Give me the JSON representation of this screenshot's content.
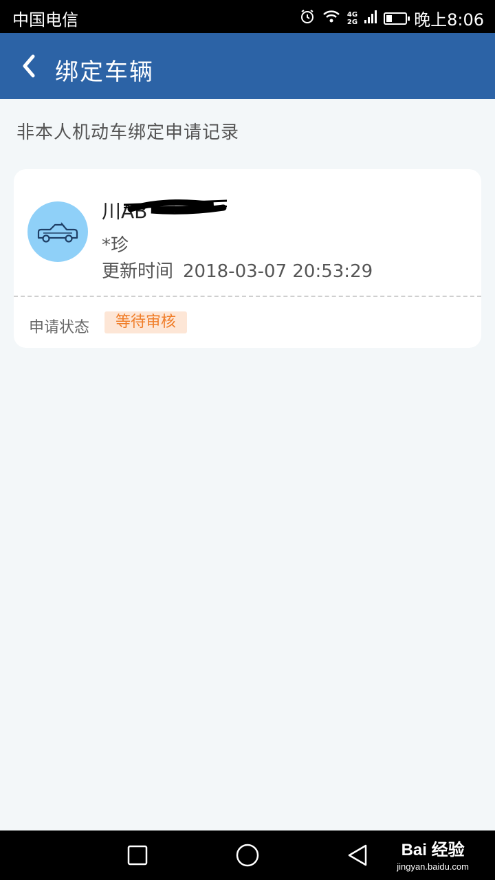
{
  "status_bar": {
    "carrier": "中国电信",
    "network": "4G",
    "network2": "2G",
    "time": "晚上8:06",
    "icons": [
      "alarm-icon",
      "wifi-icon",
      "signal-icon",
      "battery-icon"
    ]
  },
  "app_bar": {
    "back_icon": "chevron-left-icon",
    "title": "绑定车辆"
  },
  "section": {
    "title": "非本人机动车绑定申请记录"
  },
  "record": {
    "icon": "car-icon",
    "plate": "川AB",
    "owner": "*珍",
    "updated_label": "更新时间",
    "updated_value": "2018-03-07 20:53:29",
    "status_label": "申请状态",
    "status_value": "等待审核"
  },
  "nav_bar": {
    "icons": [
      "recent-apps-icon",
      "home-icon",
      "back-icon"
    ]
  },
  "watermark": {
    "brand": "Bai 经验",
    "site": "jingyan.baidu.com"
  },
  "colors": {
    "app_bar": "#2c63a6",
    "avatar": "#8fd0f8",
    "badge_bg": "#fde6d6",
    "badge_text": "#f07d28"
  }
}
